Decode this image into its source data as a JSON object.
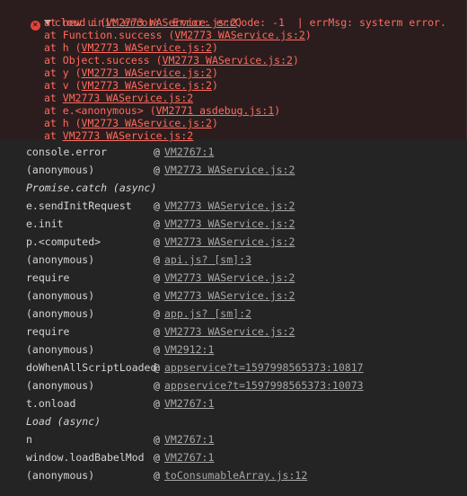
{
  "error": {
    "header": "cloud init error:  Error: errCode: -1  | errMsg: systerm error.",
    "frames": [
      {
        "prefix": "at new u (",
        "src": "VM2773 WAService.js:2",
        "suffix": ")"
      },
      {
        "prefix": "at Function.success (",
        "src": "VM2773 WAService.js:2",
        "suffix": ")"
      },
      {
        "prefix": "at h (",
        "src": "VM2773 WAService.js:2",
        "suffix": ")"
      },
      {
        "prefix": "at Object.success (",
        "src": "VM2773 WAService.js:2",
        "suffix": ")"
      },
      {
        "prefix": "at y (",
        "src": "VM2773 WAService.js:2",
        "suffix": ")"
      },
      {
        "prefix": "at v (",
        "src": "VM2773 WAService.js:2",
        "suffix": ")"
      },
      {
        "prefix": "at ",
        "src": "VM2773 WAService.js:2",
        "suffix": ""
      },
      {
        "prefix": "at e.<anonymous> (",
        "src": "VM2771 asdebug.js:1",
        "suffix": ")"
      },
      {
        "prefix": "at h (",
        "src": "VM2773 WAService.js:2",
        "suffix": ")"
      },
      {
        "prefix": "at ",
        "src": "VM2773 WAService.js:2",
        "suffix": ""
      }
    ]
  },
  "stack": [
    {
      "fn": "console.error",
      "src": "VM2767:1"
    },
    {
      "fn": "(anonymous)",
      "src": "VM2773 WAService.js:2"
    },
    {
      "async": "Promise.catch (async)"
    },
    {
      "fn": "e.sendInitRequest",
      "src": "VM2773 WAService.js:2"
    },
    {
      "fn": "e.init",
      "src": "VM2773 WAService.js:2"
    },
    {
      "fn": "p.<computed>",
      "src": "VM2773 WAService.js:2"
    },
    {
      "fn": "(anonymous)",
      "src": "api.js? [sm]:3"
    },
    {
      "fn": "require",
      "src": "VM2773 WAService.js:2"
    },
    {
      "fn": "(anonymous)",
      "src": "VM2773 WAService.js:2"
    },
    {
      "fn": "(anonymous)",
      "src": "app.js? [sm]:2"
    },
    {
      "fn": "require",
      "src": "VM2773 WAService.js:2"
    },
    {
      "fn": "(anonymous)",
      "src": "VM2912:1"
    },
    {
      "fn": "doWhenAllScriptLoaded",
      "src": "appservice?t=1597998565373:10817"
    },
    {
      "fn": "(anonymous)",
      "src": "appservice?t=1597998565373:10073"
    },
    {
      "fn": "t.onload",
      "src": "VM2767:1"
    },
    {
      "async": "Load (async)"
    },
    {
      "fn": "n",
      "src": "VM2767:1"
    },
    {
      "fn": "window.loadBabelMod",
      "src": "VM2767:1"
    },
    {
      "fn": "(anonymous)",
      "src": "toConsumableArray.js:12"
    }
  ],
  "at_symbol": "@",
  "colors": {
    "background": "#242424",
    "error_bg": "#2b1d1d",
    "error_text": "#ff6b5f"
  }
}
